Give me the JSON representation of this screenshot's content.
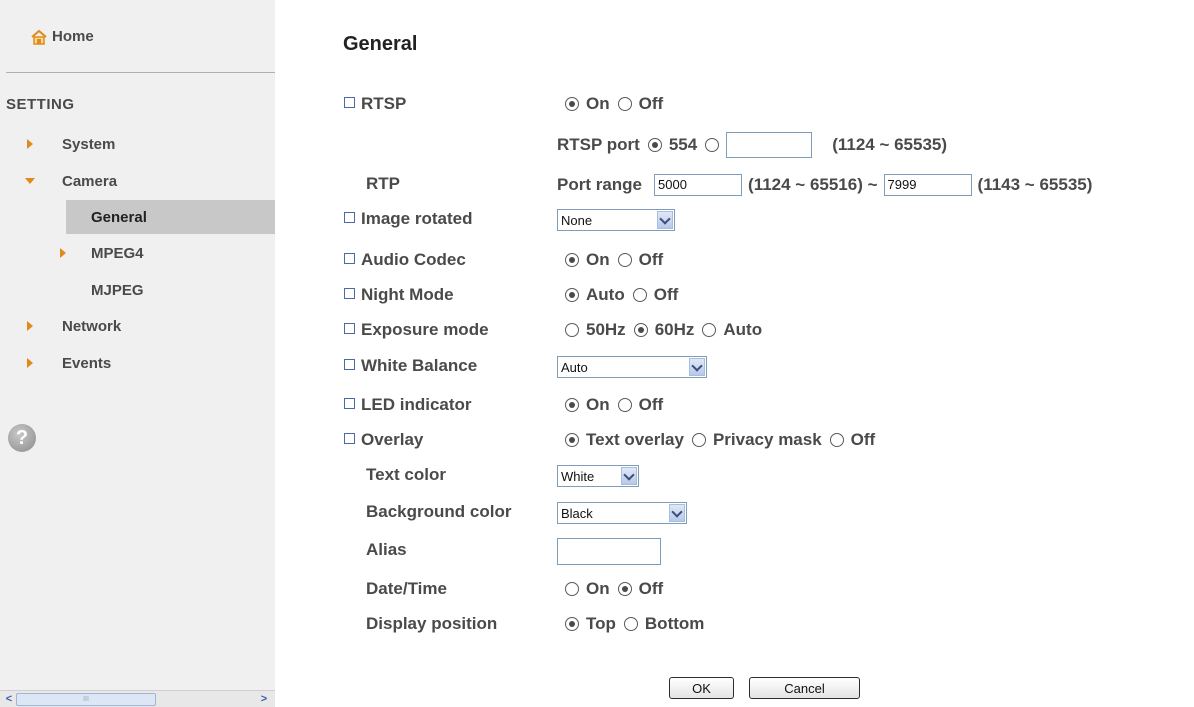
{
  "sidebar": {
    "home": "Home",
    "section": "SETTING",
    "items": [
      {
        "label": "System"
      },
      {
        "label": "Camera"
      },
      {
        "label": "General"
      },
      {
        "label": "MPEG4"
      },
      {
        "label": "MJPEG"
      },
      {
        "label": "Network"
      },
      {
        "label": "Events"
      }
    ],
    "help": "?",
    "scroll_left": "<",
    "scroll_right": ">",
    "scroll_thumb": "III"
  },
  "main": {
    "title": "General",
    "rtsp": {
      "label": "RTSP",
      "on": "On",
      "off": "Off",
      "selected": "On"
    },
    "rtsp_port": {
      "label": "RTSP port",
      "default": "554",
      "value": "",
      "range": "(1124 ~ 65535)"
    },
    "rtp": {
      "label": "RTP",
      "port_range": "Port range",
      "start": "5000",
      "start_range": "(1124 ~ 65516) ~",
      "end": "7999",
      "end_range": "(1143 ~ 65535)"
    },
    "image_rotated": {
      "label": "Image rotated",
      "value": "None"
    },
    "audio_codec": {
      "label": "Audio Codec",
      "on": "On",
      "off": "Off",
      "selected": "On"
    },
    "night_mode": {
      "label": "Night Mode",
      "auto": "Auto",
      "off": "Off",
      "selected": "Auto"
    },
    "exposure_mode": {
      "label": "Exposure mode",
      "opt1": "50Hz",
      "opt2": "60Hz",
      "opt3": "Auto",
      "selected": "60Hz"
    },
    "white_balance": {
      "label": "White Balance",
      "value": "Auto"
    },
    "led_indicator": {
      "label": "LED indicator",
      "on": "On",
      "off": "Off",
      "selected": "On"
    },
    "overlay": {
      "label": "Overlay",
      "opt1": "Text overlay",
      "opt2": "Privacy mask",
      "opt3": "Off",
      "selected": "Text overlay"
    },
    "text_color": {
      "label": "Text color",
      "value": "White"
    },
    "background_color": {
      "label": "Background color",
      "value": "Black"
    },
    "alias": {
      "label": "Alias",
      "value": ""
    },
    "date_time": {
      "label": "Date/Time",
      "on": "On",
      "off": "Off",
      "selected": "Off"
    },
    "display_position": {
      "label": "Display position",
      "top": "Top",
      "bottom": "Bottom",
      "selected": "Top"
    },
    "ok": "OK",
    "cancel": "Cancel"
  },
  "colors": {
    "accent_triangle": "#e08a1e",
    "sidebar_bg": "#f0f0f0",
    "selected_bg": "#c8c8c8",
    "text": "#4a4a4a"
  }
}
